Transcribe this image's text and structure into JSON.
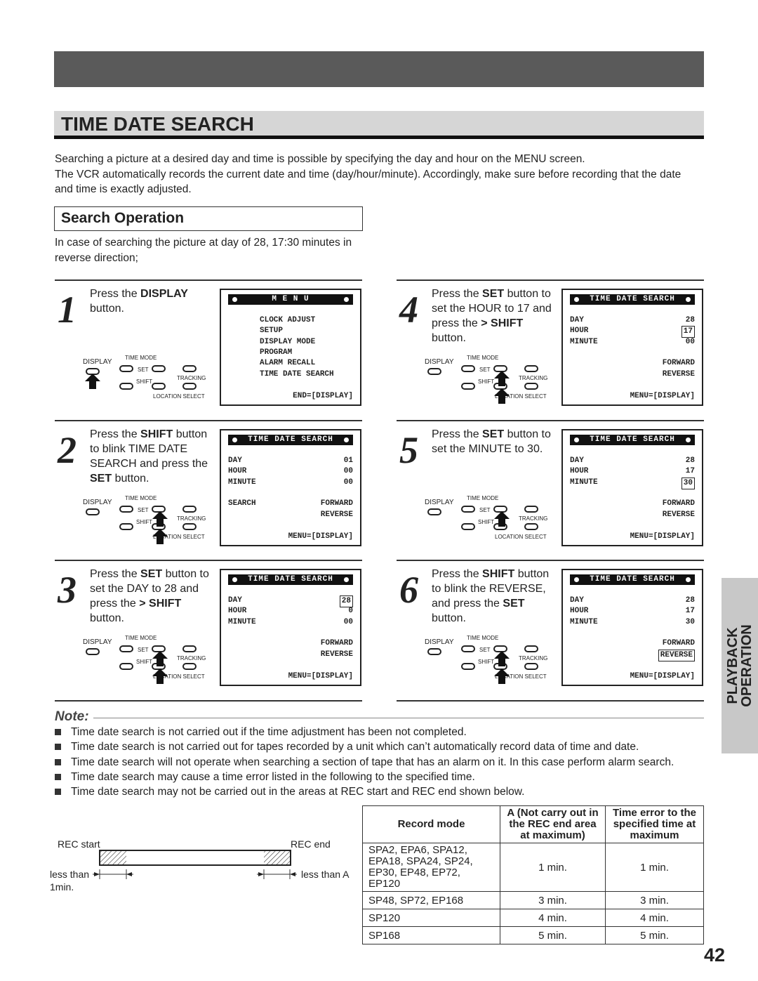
{
  "title": "TIME DATE SEARCH",
  "intro": [
    "Searching a picture at a desired day and time is possible by specifying the day and hour on the MENU screen.",
    "The VCR automatically records the current date and time (day/hour/minute). Accordingly, make sure before recording that the date",
    "and time is exactly adjusted."
  ],
  "subheading": "Search Operation",
  "case_text": [
    "In case of searching the picture at day of 28, 17:30 minutes in",
    "reverse direction;"
  ],
  "remote_labels": {
    "display": "DISPLAY",
    "time_mode": "TIME MODE",
    "set": "SET",
    "shift": "SHIFT",
    "tracking": "TRACKING",
    "location_select": "LOCATION SELECT"
  },
  "steps": [
    {
      "num": "1",
      "instr": [
        {
          "t": "Press the "
        },
        {
          "t": "DISPLAY",
          "b": true
        },
        {
          "t": " button."
        }
      ],
      "arrows": [
        "display"
      ],
      "screen": {
        "title": "M E N U",
        "rows": [
          {
            "l": "CLOCK ADJUST",
            "indent": true
          },
          {
            "l": "SETUP",
            "indent": true
          },
          {
            "l": "DISPLAY MODE",
            "indent": true
          },
          {
            "l": "PROGRAM",
            "indent": true
          },
          {
            "l": "ALARM RECALL",
            "indent": true
          },
          {
            "l": "TIME DATE SEARCH",
            "indent": true
          }
        ],
        "footer": "END=[DISPLAY]"
      }
    },
    {
      "num": "2",
      "instr": [
        {
          "t": "Press the "
        },
        {
          "t": "SHIFT",
          "b": true
        },
        {
          "t": " button to blink TIME DATE SEARCH and press the "
        },
        {
          "t": "SET",
          "b": true
        },
        {
          "t": " button."
        }
      ],
      "arrows": [
        "set",
        "shift"
      ],
      "screen": {
        "title": "TIME DATE SEARCH",
        "rows": [
          {
            "l": "DAY",
            "r": "01"
          },
          {
            "l": "HOUR",
            "r": "00"
          },
          {
            "l": "MINUTE",
            "r": "00"
          },
          {},
          {
            "l": "SEARCH",
            "r": "FORWARD"
          },
          {
            "r": "REVERSE"
          }
        ],
        "footer": "MENU=[DISPLAY]"
      }
    },
    {
      "num": "3",
      "instr": [
        {
          "t": "Press the "
        },
        {
          "t": "SET",
          "b": true
        },
        {
          "t": " button to set the DAY to 28 and press the "
        },
        {
          "t": "> SHIFT",
          "b": true
        },
        {
          "t": " button."
        }
      ],
      "arrows": [
        "set",
        "shift"
      ],
      "screen": {
        "title": "TIME DATE SEARCH",
        "rows": [
          {
            "l": "DAY",
            "r": "28",
            "box": true
          },
          {
            "l": "HOUR",
            "r": "0"
          },
          {
            "l": "MINUTE",
            "r": "00"
          },
          {},
          {
            "r": "FORWARD"
          },
          {
            "r": "REVERSE"
          }
        ],
        "footer": "MENU=[DISPLAY]"
      }
    },
    {
      "num": "4",
      "instr": [
        {
          "t": "Press the "
        },
        {
          "t": "SET",
          "b": true
        },
        {
          "t": " button to set the HOUR to 17 and press the "
        },
        {
          "t": "> SHIFT",
          "b": true
        },
        {
          "t": " button."
        }
      ],
      "arrows": [
        "set",
        "shift"
      ],
      "screen": {
        "title": "TIME DATE SEARCH",
        "rows": [
          {
            "l": "DAY",
            "r": "28"
          },
          {
            "l": "HOUR",
            "r": "17",
            "box": true
          },
          {
            "l": "MINUTE",
            "r": "00"
          },
          {},
          {
            "r": "FORWARD"
          },
          {
            "r": "REVERSE"
          }
        ],
        "footer": "MENU=[DISPLAY]"
      }
    },
    {
      "num": "5",
      "instr": [
        {
          "t": "Press the "
        },
        {
          "t": "SET",
          "b": true
        },
        {
          "t": " button to set the MINUTE to 30."
        }
      ],
      "arrows": [
        "set"
      ],
      "screen": {
        "title": "TIME DATE SEARCH",
        "rows": [
          {
            "l": "DAY",
            "r": "28"
          },
          {
            "l": "HOUR",
            "r": "17"
          },
          {
            "l": "MINUTE",
            "r": "30",
            "box": true
          },
          {},
          {
            "r": "FORWARD"
          },
          {
            "r": "REVERSE"
          }
        ],
        "footer": "MENU=[DISPLAY]"
      }
    },
    {
      "num": "6",
      "instr": [
        {
          "t": "Press the "
        },
        {
          "t": "SHIFT",
          "b": true
        },
        {
          "t": " button to blink the REVERSE, and press the "
        },
        {
          "t": "SET",
          "b": true
        },
        {
          "t": " button."
        }
      ],
      "arrows": [
        "set",
        "shift"
      ],
      "screen": {
        "title": "TIME DATE SEARCH",
        "rows": [
          {
            "l": "DAY",
            "r": "28"
          },
          {
            "l": "HOUR",
            "r": "17"
          },
          {
            "l": "MINUTE",
            "r": "30"
          },
          {},
          {
            "r": "FORWARD"
          },
          {
            "r": "REVERSE",
            "box": true
          }
        ],
        "footer": "MENU=[DISPLAY]"
      }
    }
  ],
  "note_label": "Note:",
  "notes": [
    "Time date search is not carried out if the time adjustment has been not completed.",
    "Time date search is not carried out for tapes recorded by a unit which can’t automatically record data of time and date.",
    "Time date search will not operate when searching a section of tape that has an alarm on it. In this case perform alarm search.",
    "Time date search may cause a time error listed in the following to the specified time.",
    "Time date search may not be carried out in the areas at REC start and REC end shown below."
  ],
  "diagram": {
    "rec_start": "REC start",
    "rec_end": "REC end",
    "left_label": "less than",
    "left_label2": "1min.",
    "right_label": "less than A"
  },
  "table": {
    "headers": [
      "Record mode",
      "A (Not carry out in the REC end area at maximum)",
      "Time error to the specified time at maximum"
    ],
    "rows": [
      [
        "SPA2, EPA6, SPA12, EPA18, SPA24, SP24, EP30, EP48, EP72, EP120",
        "1 min.",
        "1 min."
      ],
      [
        "SP48, SP72, EP168",
        "3 min.",
        "3 min."
      ],
      [
        "SP120",
        "4 min.",
        "4 min."
      ],
      [
        "SP168",
        "5 min.",
        "5 min."
      ]
    ]
  },
  "side_tab": [
    "PLAYBACK",
    "OPERATION"
  ],
  "page_number": "42"
}
